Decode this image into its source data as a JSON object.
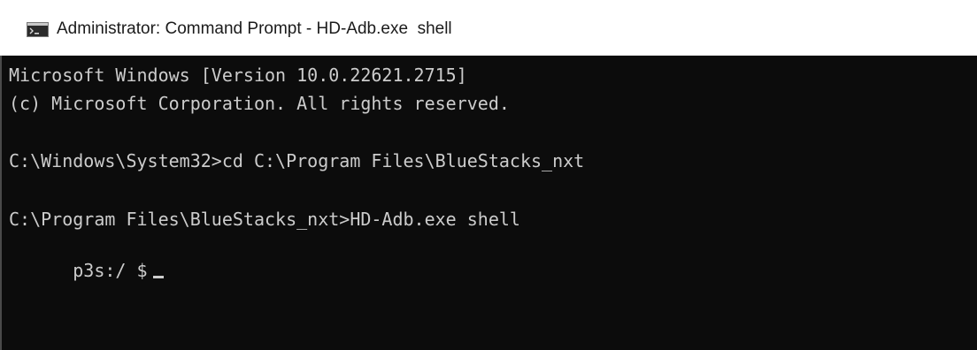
{
  "window": {
    "title": "Administrator: Command Prompt - HD-Adb.exe  shell",
    "icon": "cmd-console-icon"
  },
  "console": {
    "lines": [
      "Microsoft Windows [Version 10.0.22621.2715]",
      "(c) Microsoft Corporation. All rights reserved.",
      "",
      "C:\\Windows\\System32>cd C:\\Program Files\\BlueStacks_nxt",
      "",
      "C:\\Program Files\\BlueStacks_nxt>HD-Adb.exe shell"
    ],
    "prompt": "p3s:/ $",
    "colors": {
      "background": "#0c0c0c",
      "text": "#cccccc"
    }
  }
}
